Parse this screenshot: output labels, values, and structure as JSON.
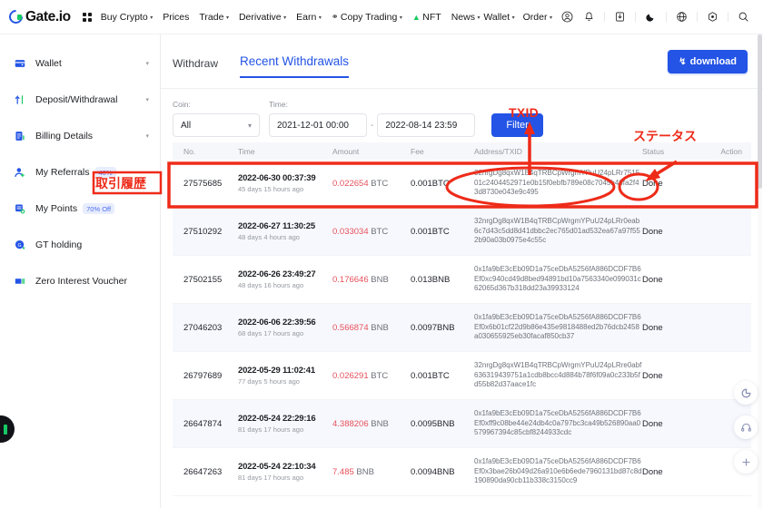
{
  "brand": {
    "name": "Gate.io",
    "grid_icon": "apps-grid-icon"
  },
  "topnav": {
    "items": [
      {
        "label": "Buy Crypto",
        "caret": "▾"
      },
      {
        "label": "Prices",
        "caret": ""
      },
      {
        "label": "Trade",
        "caret": "▾"
      },
      {
        "label": "Derivative",
        "caret": "▾"
      },
      {
        "label": "Earn",
        "caret": "▾"
      },
      {
        "label": "Copy Trading",
        "caret": "▾",
        "icon": "shield-icon"
      },
      {
        "label": "NFT",
        "caret": "",
        "icon": "leaf-icon"
      },
      {
        "label": "News",
        "caret": "▾"
      }
    ],
    "right_items": [
      {
        "label": "Wallet",
        "caret": "▾"
      },
      {
        "label": "Order",
        "caret": "▾"
      }
    ],
    "right_icons": [
      "user-icon",
      "bell-icon",
      "download-box-icon",
      "dark-mode-icon",
      "language-globe-icon",
      "settings-icon",
      "search-icon"
    ]
  },
  "sidebar": {
    "items": [
      {
        "label": "Wallet",
        "icon": "wallet-icon",
        "caret": "▾",
        "badge": ""
      },
      {
        "label": "Deposit/Withdrawal",
        "icon": "deposit-withdrawal-icon",
        "caret": "▾",
        "badge": ""
      },
      {
        "label": "Billing Details",
        "icon": "billing-details-icon",
        "caret": "▾",
        "badge": ""
      },
      {
        "label": "My Referrals",
        "icon": "referrals-icon",
        "caret": "",
        "badge": "40%"
      },
      {
        "label": "My Points",
        "icon": "points-icon",
        "caret": "",
        "badge": "70% Off"
      },
      {
        "label": "GT holding",
        "icon": "gt-holding-icon",
        "caret": "",
        "badge": ""
      },
      {
        "label": "Zero Interest Voucher",
        "icon": "voucher-icon",
        "caret": "",
        "badge": ""
      }
    ]
  },
  "main": {
    "download_label": "download",
    "download_icon": "download-icon",
    "tabs": [
      {
        "label": "Withdraw",
        "active": false
      },
      {
        "label": "Recent Withdrawals",
        "active": true
      }
    ],
    "filters": {
      "coin_label": "Coin:",
      "coin_value": "All",
      "time_label": "Time:",
      "date_from": "2021-12-01 00:00",
      "date_to": "2022-08-14 23:59",
      "separator": "-",
      "filter_button": "Filter"
    },
    "table": {
      "columns": [
        "No.",
        "Time",
        "Amount",
        "Fee",
        "Address/TXID",
        "Status",
        "Action"
      ],
      "rows": [
        {
          "no": "27575685",
          "time": "2022-06-30 00:37:39",
          "ago": "45 days 15 hours ago",
          "amount_num": "0.022654",
          "amount_cur": "BTC",
          "fee": "0.001BTC",
          "address": "32nrgDg8qxW1B4qTRBCpWrgmYPuU24pLRr751501c2404452971e0b15f0ebfb789e08c7045b46fa2f43d8730e043e9c495",
          "status": "Done",
          "action": ""
        },
        {
          "no": "27510292",
          "time": "2022-06-27 11:30:25",
          "ago": "48 days 4 hours ago",
          "amount_num": "0.033034",
          "amount_cur": "BTC",
          "fee": "0.001BTC",
          "address": "32nrgDg8qxW1B4qTRBCpWrgmYPuU24pLRr0eab6c7d43c5dd8d41dbbc2ec765d01ad532ea67a97f552b90a03b0975e4c55c",
          "status": "Done",
          "action": ""
        },
        {
          "no": "27502155",
          "time": "2022-06-26 23:49:27",
          "ago": "48 days 16 hours ago",
          "amount_num": "0.176646",
          "amount_cur": "BNB",
          "fee": "0.013BNB",
          "address": "0x1fa9bE3cEb09D1a75ceDbA5256fA886DCDF7B6Ef0xc940cd49d8bed94891bd10a7563340e099031c62065d367b318dd23a39933124",
          "status": "Done",
          "action": ""
        },
        {
          "no": "27046203",
          "time": "2022-06-06 22:39:56",
          "ago": "68 days 17 hours ago",
          "amount_num": "0.566874",
          "amount_cur": "BNB",
          "fee": "0.0097BNB",
          "address": "0x1fa9bE3cEb09D1a75ceDbA5256fA886DCDF7B6Ef0x6b01cf22d9b86e435e9818488ed2b76dcb2458a030655925eb30facaf850cb37",
          "status": "Done",
          "action": ""
        },
        {
          "no": "26797689",
          "time": "2022-05-29 11:02:41",
          "ago": "77 days 5 hours ago",
          "amount_num": "0.026291",
          "amount_cur": "BTC",
          "fee": "0.001BTC",
          "address": "32nrgDg8qxW1B4qTRBCpWrgmYPuU24pLRre0abf636319439751a1cdb8bcc4d884b78f6f09a0c233b5fd55b82d37aace1fc",
          "status": "Done",
          "action": ""
        },
        {
          "no": "26647874",
          "time": "2022-05-24 22:29:16",
          "ago": "81 days 17 hours ago",
          "amount_num": "4.388206",
          "amount_cur": "BNB",
          "fee": "0.0095BNB",
          "address": "0x1fa9bE3cEb09D1a75ceDbA5256fA886DCDF7B6Ef0xff9c08be44e24db4c0a797bc3ca49b526890aa0579967394c85cbf8244933cdc",
          "status": "Done",
          "action": ""
        },
        {
          "no": "26647263",
          "time": "2022-05-24 22:10:34",
          "ago": "81 days 17 hours ago",
          "amount_num": "7.485",
          "amount_cur": "BNB",
          "fee": "0.0094BNB",
          "address": "0x1fa9bE3cEb09D1a75ceDbA5256fA886DCDF7B6Ef0x3bae26b049d26a910e6b6ede7960131bd87c8d190890da90cb11b338c3150cc9",
          "status": "Done",
          "action": ""
        }
      ]
    }
  },
  "annotations": {
    "txid": "TXID",
    "status": "ステータス",
    "history": "取引履歴",
    "color": "#ee2b19"
  },
  "floating_buttons": [
    {
      "icon": "refresh-icon",
      "glyph": "↻"
    },
    {
      "icon": "headset-support-icon",
      "glyph": "⌒"
    },
    {
      "icon": "plus-icon",
      "glyph": "+"
    }
  ]
}
